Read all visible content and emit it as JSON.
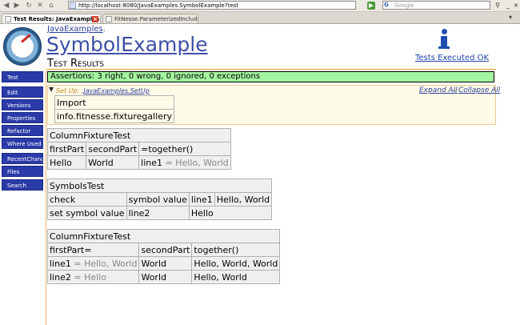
{
  "browser": {
    "url": "http://localhost:8080/JavaExamples.SymbolExample?test",
    "search_placeholder": "Google",
    "search_engine_glyph": "G",
    "tabs": [
      {
        "label": "Test Results: JavaExamples...."
      },
      {
        "label": "FitNesse.ParameterizedIncludes"
      }
    ]
  },
  "page": {
    "breadcrumb": "JavaExamples",
    "breadcrumb_suffix": ".",
    "title": "SymbolExample",
    "subtitle": "Test Results",
    "tests_executed": "Tests Executed OK",
    "assertions": "Assertions: 3 right, 0 wrong, 0 ignored, 0 exceptions"
  },
  "sidebar": {
    "items": [
      {
        "label": "Test"
      },
      {
        "label": "Edit"
      },
      {
        "label": "Versions"
      },
      {
        "label": "Properties"
      },
      {
        "label": "Refactor"
      },
      {
        "label": "Where Used"
      },
      {
        "label": "RecentChanges"
      },
      {
        "label": "Files"
      },
      {
        "label": "Search"
      }
    ]
  },
  "setup": {
    "toggle": "▼",
    "label": "Set Up:",
    "link": ".JavaExamples.SetUp",
    "expand_all": "Expand All",
    "separator": "|",
    "collapse_all": "Collapse All",
    "table": {
      "row1": "Import",
      "row2": "info.fitnesse.fixturegallery"
    }
  },
  "table1": {
    "title": "ColumnFixtureTest",
    "headers": [
      "firstPart",
      "secondPart",
      "=together()"
    ],
    "row": {
      "c1": "Hello",
      "c2": "World",
      "c3_symbol": "line1",
      "c3_value": " = Hello, World"
    }
  },
  "table2": {
    "title": "SymbolsTest",
    "row1": {
      "c1": "check",
      "c2": "symbol value",
      "c3": "line1",
      "c4": "Hello, World"
    },
    "row2": {
      "c1": "set symbol value",
      "c2": "line2",
      "c3": "Hello"
    }
  },
  "table3": {
    "title": "ColumnFixtureTest",
    "headers": [
      "firstPart=",
      "secondPart",
      "together()"
    ],
    "row1": {
      "c1_symbol": "line1",
      "c1_value": " = Hello, World",
      "c2": "World",
      "c3": "Hello, World, World"
    },
    "row2": {
      "c1_symbol": "line2",
      "c1_value": " = Hello",
      "c2": "World",
      "c3": "Hello, World"
    }
  },
  "colors": {
    "pass": "#a4f5a0",
    "nav": "#2a3ba8",
    "title": "#3d4fa8",
    "rule": "#f0a020"
  }
}
